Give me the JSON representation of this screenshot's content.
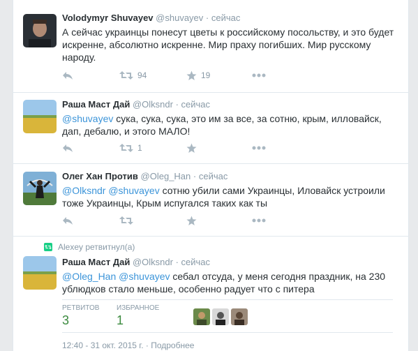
{
  "tweets": [
    {
      "fullname": "Volodymyr Shuvayev",
      "username": "@shuvayev",
      "sep": "·",
      "time": "сейчас",
      "text": "А сейчас украинцы понесут цветы к российскому посольству, и это будет искренне, абсолютно искренне. Мир праху погибших. Мир русскому народу.",
      "retweets": "94",
      "favorites": "19"
    },
    {
      "fullname": "Раша Маст Дай",
      "username": "@Olksndr",
      "sep": "·",
      "time": "сейчас",
      "mention1": "@shuvayev",
      "text": " сука, сука, сука, это им за все, за сотню, крым, илловайск, дап, дебалю, и этого МАЛО!",
      "retweets": "1"
    },
    {
      "fullname": "Олег Хан Против",
      "username": "@Oleg_Han",
      "sep": "·",
      "time": "сейчас",
      "mention1": "@Olksndr",
      "mention2": "@shuvayev",
      "text": " сотню убили сами Украинцы, Иловайск устроили тоже Украинцы, Крым испугался таких как ты"
    },
    {
      "retweeted_by": "Alexey ретвитнул(а)",
      "fullname": "Раша Маст Дай",
      "username": "@Olksndr",
      "sep": "·",
      "time": "сейчас",
      "mention1": "@Oleg_Han",
      "mention2": "@shuvayev",
      "text": " себал отсуда, у меня сегодня праздник, на 230 ублюдков стало меньше, особенно радует что с питера",
      "retweets_label": "РЕТВИТОВ",
      "retweets": "3",
      "favorites_label": "ИЗБРАННОЕ",
      "favorites": "1",
      "date": "12:40 - 31 окт. 2015 г. · Подробнее"
    }
  ],
  "icons": {
    "reply": "reply-icon",
    "retweet": "retweet-icon",
    "favorite": "star-icon",
    "more": "more-icon"
  },
  "colors": {
    "link": "#3b94d9",
    "meta": "#8899a6",
    "retweet_green": "#19cf86"
  }
}
